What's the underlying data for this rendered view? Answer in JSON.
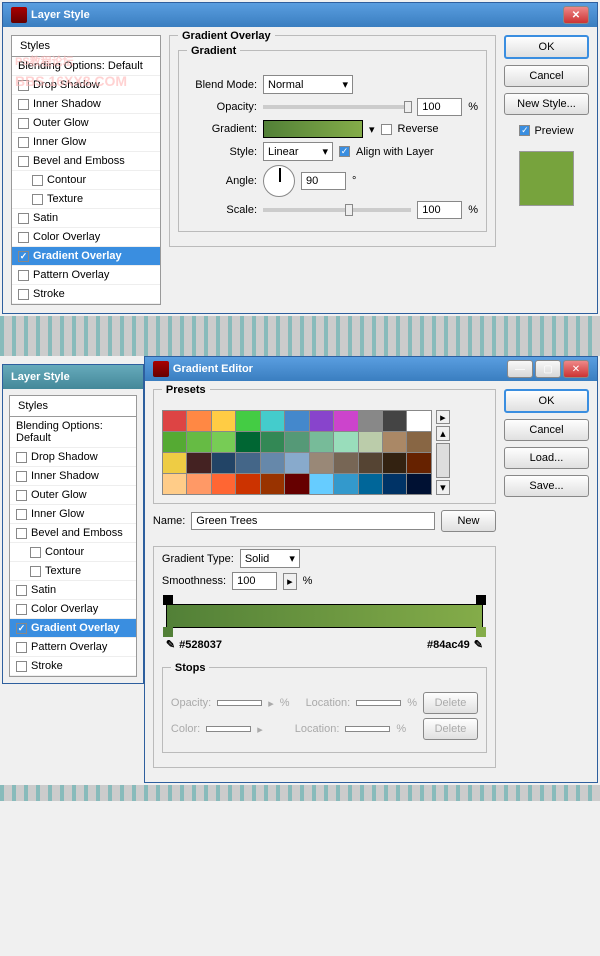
{
  "watermark_line1": "PS教程论坛",
  "watermark_line2": "BBS.16XX8.COM",
  "dialog1": {
    "title": "Layer Style",
    "styles_header": "Styles",
    "blending_options": "Blending Options: Default",
    "items": [
      "Drop Shadow",
      "Inner Shadow",
      "Outer Glow",
      "Inner Glow",
      "Bevel and Emboss",
      "Contour",
      "Texture",
      "Satin",
      "Color Overlay",
      "Gradient Overlay",
      "Pattern Overlay",
      "Stroke"
    ],
    "group_title": "Gradient Overlay",
    "subgroup": "Gradient",
    "blend_mode_label": "Blend Mode:",
    "blend_mode_value": "Normal",
    "opacity_label": "Opacity:",
    "opacity_value": "100",
    "gradient_label": "Gradient:",
    "reverse_label": "Reverse",
    "style_label": "Style:",
    "style_value": "Linear",
    "align_label": "Align with Layer",
    "angle_label": "Angle:",
    "angle_value": "90",
    "scale_label": "Scale:",
    "scale_value": "100",
    "percent": "%",
    "degree": "°",
    "btn_ok": "OK",
    "btn_cancel": "Cancel",
    "btn_newstyle": "New Style...",
    "preview_label": "Preview"
  },
  "dialog2": {
    "title": "Layer Style"
  },
  "dialog3": {
    "title": "Gradient Editor",
    "presets_label": "Presets",
    "name_label": "Name:",
    "name_value": "Green Trees",
    "btn_new": "New",
    "gradtype_label": "Gradient Type:",
    "gradtype_value": "Solid",
    "smoothness_label": "Smoothness:",
    "smoothness_value": "100",
    "percent": "%",
    "stops_label": "Stops",
    "opacity_label": "Opacity:",
    "location_label": "Location:",
    "color_label": "Color:",
    "btn_delete": "Delete",
    "btn_ok": "OK",
    "btn_cancel": "Cancel",
    "btn_load": "Load...",
    "btn_save": "Save...",
    "color_left": "#528037",
    "color_right": "#84ac49"
  },
  "preset_colors": [
    "#d44",
    "#f84",
    "#fc4",
    "#4c4",
    "#4cc",
    "#48c",
    "#84c",
    "#c4c",
    "#888",
    "#444",
    "#fff",
    "#5a3",
    "#6b4",
    "#7c5",
    "#063",
    "#385",
    "#597",
    "#7b9",
    "#9db",
    "#bca",
    "#a86",
    "#864",
    "#ec4",
    "#422",
    "#246",
    "#468",
    "#68a",
    "#8ac",
    "#987",
    "#765",
    "#543",
    "#321",
    "#620",
    "#fc8",
    "#f96",
    "#f63",
    "#c30",
    "#930",
    "#600",
    "#6cf",
    "#39c",
    "#069",
    "#036",
    "#013"
  ]
}
